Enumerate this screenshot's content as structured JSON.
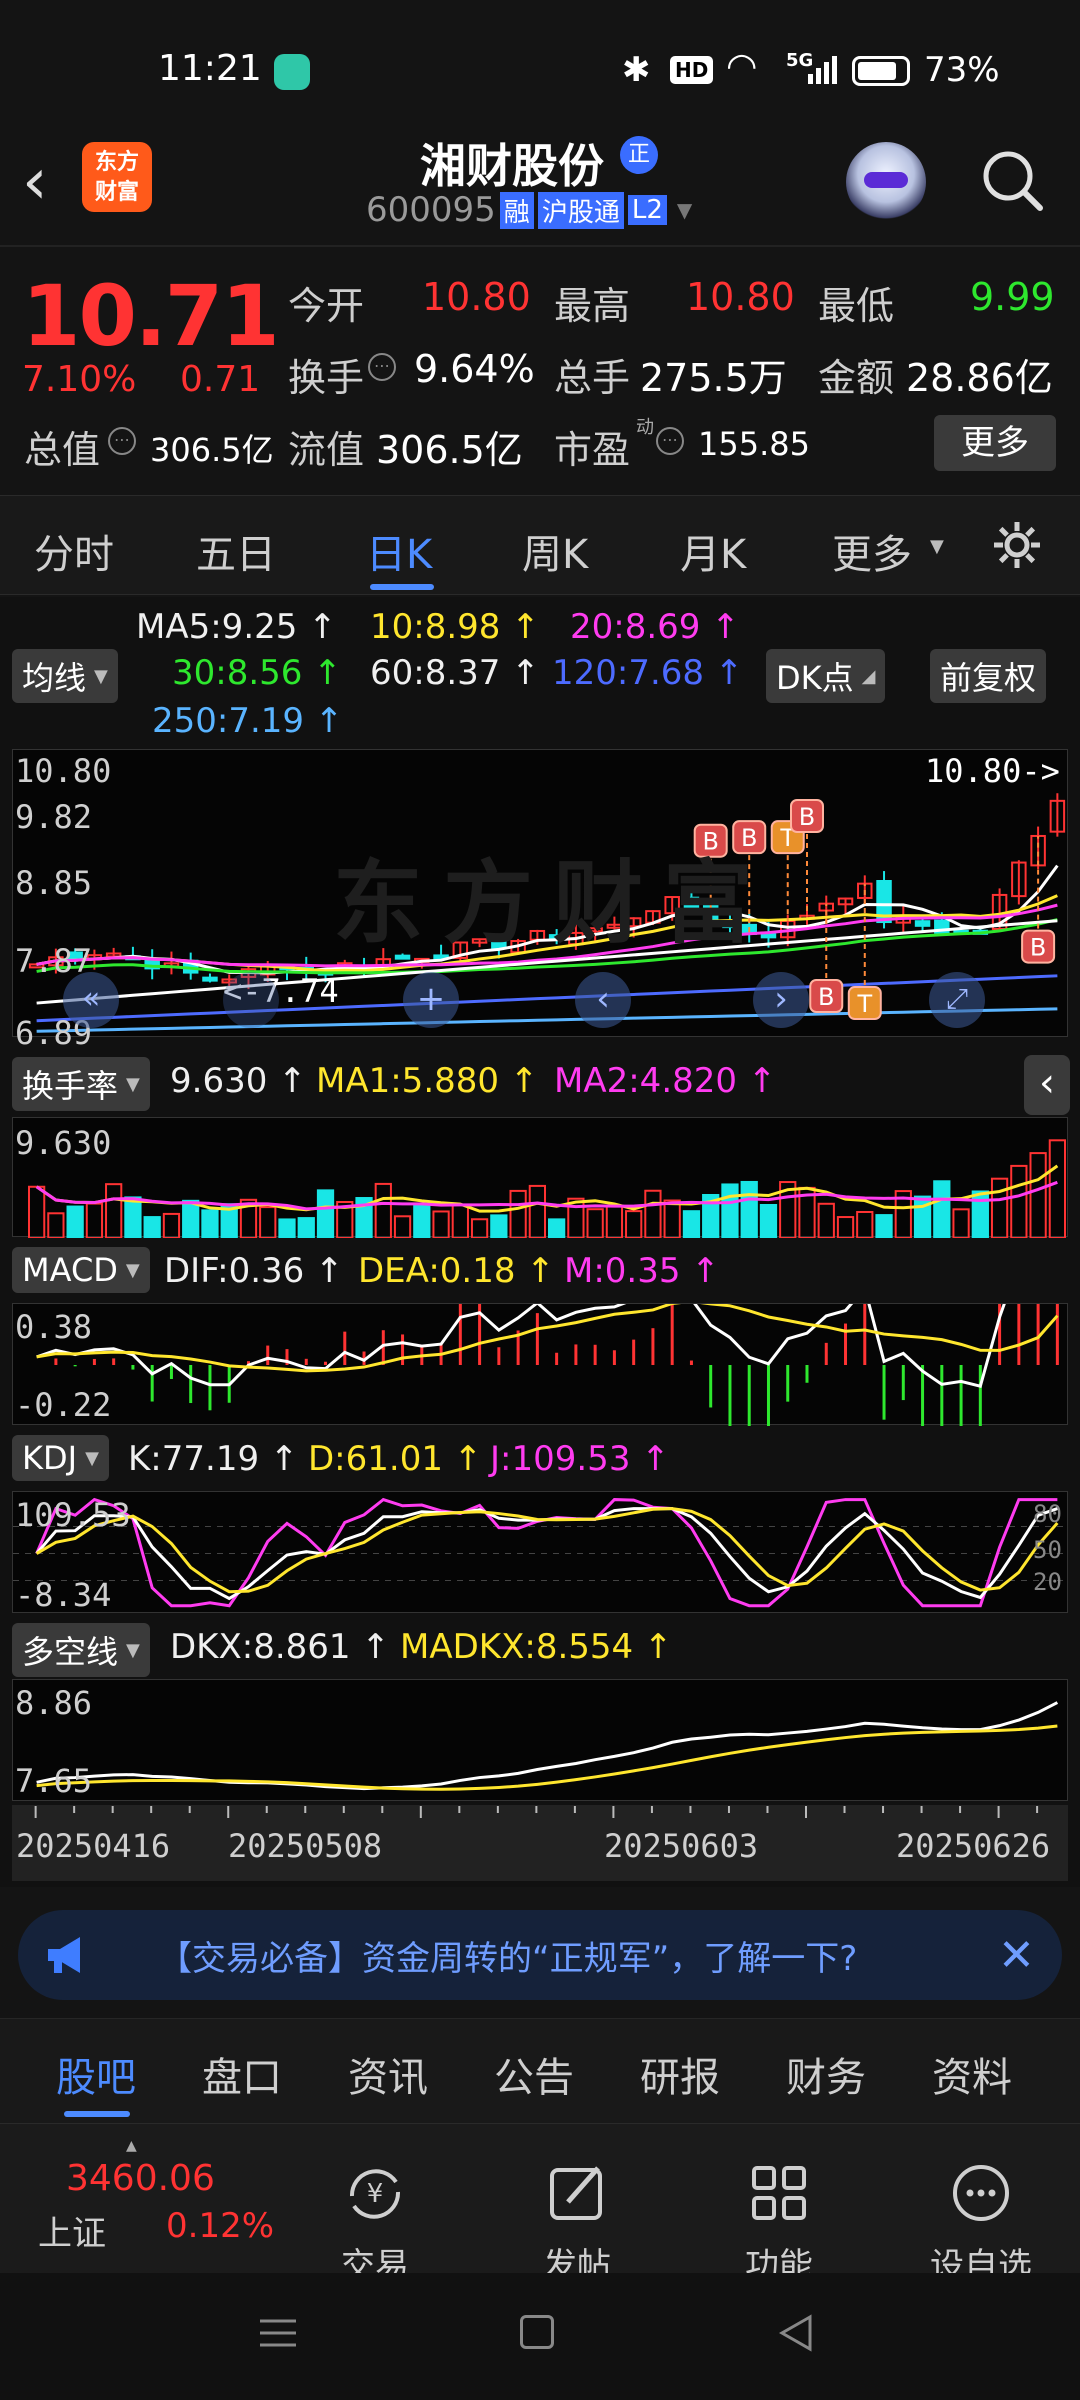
{
  "status": {
    "time": "11:21",
    "hd": "HD",
    "net": "5G",
    "battery": "73%"
  },
  "header": {
    "logo_top": "东方",
    "logo_bottom": "财富",
    "name": "湘财股份",
    "badge": "正",
    "code": "600095",
    "tag_margin": "融",
    "tag_connect": "沪股通",
    "tag_level": "L2"
  },
  "quote": {
    "price": "10.71",
    "change_pct": "7.10%",
    "change": "0.71",
    "rows": [
      [
        {
          "label": "今开",
          "value": "10.80",
          "color": "red"
        },
        {
          "label": "最高",
          "value": "10.80",
          "color": "red"
        },
        {
          "label": "最低",
          "value": "9.99",
          "color": "green"
        }
      ],
      [
        {
          "label": "换手",
          "value": "9.64%",
          "color": "white"
        },
        {
          "label": "总手",
          "value": "275.5万",
          "color": "white"
        },
        {
          "label": "金额",
          "value": "28.86亿",
          "color": "white"
        }
      ]
    ],
    "total_label": "总值",
    "total_value": "306.5亿",
    "float_label": "流值",
    "float_value": "306.5亿",
    "pe_label": "市盈",
    "pe_sup": "动",
    "pe_value": "155.85",
    "more_button": "更多"
  },
  "period_tabs": [
    {
      "label": "分时"
    },
    {
      "label": "五日"
    },
    {
      "label": "日K",
      "active": true
    },
    {
      "label": "周K"
    },
    {
      "label": "月K"
    },
    {
      "label": "更多"
    }
  ],
  "ma": {
    "dropdown": "均线",
    "ma5": "MA5:9.25",
    "ma10": "10:8.98",
    "ma20": "20:8.69",
    "ma30": "30:8.56",
    "ma60": "60:8.37",
    "ma120": "120:7.68",
    "ma250": "250:7.19",
    "dk_button": "DK点",
    "fq_button": "前复权"
  },
  "kline": {
    "y_top": "10.80",
    "y_mid1": "9.82",
    "y_mid2": "8.85",
    "y_mid3": "7.87",
    "y_bottom": "6.89",
    "high_label": "10.80->",
    "low_label": "<-7.74",
    "marker_b": "B",
    "marker_t": "T",
    "watermark": "东方财富"
  },
  "turnover": {
    "dropdown": "换手率",
    "value": "9.630",
    "ma1": "MA1:5.880",
    "ma2": "MA2:4.820",
    "y_top": "9.630"
  },
  "macd": {
    "dropdown": "MACD",
    "dif": "DIF:0.36",
    "dea": "DEA:0.18",
    "m": "M:0.35",
    "y_top": "0.38",
    "y_bottom": "-0.22"
  },
  "kdj": {
    "dropdown": "KDJ",
    "k": "K:77.19",
    "d": "D:61.01",
    "j": "J:109.53",
    "y_top": "109.53",
    "y_bottom": "-8.34",
    "lvl80": "80",
    "lvl50": "50",
    "lvl20": "20"
  },
  "dkx": {
    "dropdown": "多空线",
    "dkx": "DKX:8.861",
    "madkx": "MADKX:8.554",
    "y_top": "8.86",
    "y_bottom": "7.65"
  },
  "dates": [
    "20250416",
    "20250508",
    "20250603",
    "20250626"
  ],
  "banner": {
    "text": "【交易必备】资金周转的“正规军”，了解一下?"
  },
  "bottom_tabs": [
    {
      "label": "股吧",
      "active": true
    },
    {
      "label": "盘口"
    },
    {
      "label": "资讯"
    },
    {
      "label": "公告"
    },
    {
      "label": "研报"
    },
    {
      "label": "财务"
    },
    {
      "label": "资料"
    }
  ],
  "index": {
    "value": "3460.06",
    "name": "上证",
    "pct": "0.12%"
  },
  "toolbar": {
    "trade": "交易",
    "post": "发帖",
    "func": "功能",
    "watch": "设自选"
  },
  "chart_data": {
    "type": "candlestick",
    "series": [
      {
        "name": "MA5",
        "value": 9.25
      },
      {
        "name": "10",
        "value": 8.98
      },
      {
        "name": "20",
        "value": 8.69
      },
      {
        "name": "30",
        "value": 8.56
      },
      {
        "name": "60",
        "value": 8.37
      },
      {
        "name": "120",
        "value": 7.68
      },
      {
        "name": "250",
        "value": 7.19
      }
    ],
    "ylim": [
      6.89,
      10.8
    ],
    "x": [
      "20250416",
      "20250508",
      "20250603",
      "20250626"
    ],
    "turnover": {
      "value": 9.63,
      "ma1": 5.88,
      "ma2": 4.82
    },
    "macd": {
      "dif": 0.36,
      "dea": 0.18,
      "m": 0.35,
      "ylim": [
        -0.22,
        0.38
      ]
    },
    "kdj": {
      "k": 77.19,
      "d": 61.01,
      "j": 109.53,
      "ylim": [
        -8.34,
        109.53
      ]
    },
    "dkx": {
      "dkx": 8.861,
      "madkx": 8.554,
      "ylim": [
        7.65,
        8.86
      ]
    },
    "colors": {
      "up": "#ff3333",
      "down": "#19e6e6",
      "ma5": "#ffffff",
      "ma10": "#ffe62e",
      "ma20": "#ff3cf0",
      "ma30": "#2ee82e",
      "ma60": "#ffffff",
      "ma120": "#4d6bff",
      "ma250": "#5ab4ff"
    }
  }
}
